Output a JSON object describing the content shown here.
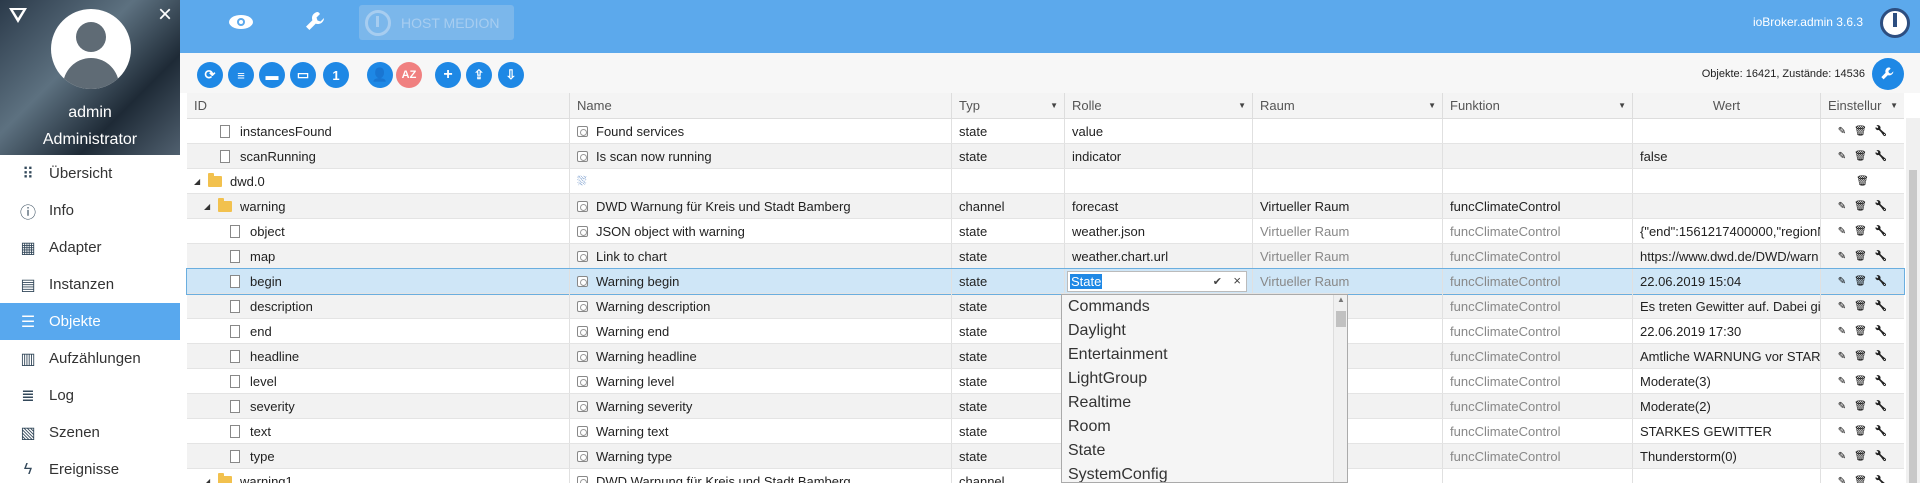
{
  "sidebar": {
    "user_name": "admin",
    "user_role": "Administrator",
    "items": [
      {
        "label": "Übersicht",
        "icon": "grid-icon"
      },
      {
        "label": "Info",
        "icon": "info-icon"
      },
      {
        "label": "Adapter",
        "icon": "store-icon"
      },
      {
        "label": "Instanzen",
        "icon": "instances-icon"
      },
      {
        "label": "Objekte",
        "icon": "list-icon",
        "active": true
      },
      {
        "label": "Aufzählungen",
        "icon": "enum-icon"
      },
      {
        "label": "Log",
        "icon": "log-icon"
      },
      {
        "label": "Szenen",
        "icon": "scenes-icon"
      },
      {
        "label": "Ereignisse",
        "icon": "bolt-icon"
      }
    ]
  },
  "topbar": {
    "host_label": "HOST MEDION",
    "version": "ioBroker.admin 3.6.3"
  },
  "toolbar": {
    "counts": "Objekte: 16421, Zustände: 14536",
    "az_label": "AZ",
    "one_label": "1"
  },
  "columns": {
    "id": "ID",
    "name": "Name",
    "typ": "Typ",
    "rolle": "Rolle",
    "raum": "Raum",
    "funktion": "Funktion",
    "wert": "Wert",
    "einstellungen": "Einstellur"
  },
  "rows": [
    {
      "id": "instancesFound",
      "name": "Found services",
      "typ": "state",
      "rolle": "value",
      "raum": "",
      "funktion": "",
      "wert": ""
    },
    {
      "id": "scanRunning",
      "name": "Is scan now running",
      "typ": "state",
      "rolle": "indicator",
      "raum": "",
      "funktion": "",
      "wert": "false"
    },
    {
      "id": "dwd.0",
      "name": "",
      "typ": "",
      "rolle": "",
      "raum": "",
      "funktion": "",
      "wert": ""
    },
    {
      "id": "warning",
      "name": "DWD Warnung für Kreis und Stadt Bamberg",
      "typ": "channel",
      "rolle": "forecast",
      "raum": "Virtueller Raum",
      "funktion": "funcClimateControl",
      "wert": ""
    },
    {
      "id": "object",
      "name": "JSON object with warning",
      "typ": "state",
      "rolle": "weather.json",
      "raum": "Virtueller Raum",
      "funktion": "funcClimateControl",
      "wert": "{\"end\":1561217400000,\"regionN"
    },
    {
      "id": "map",
      "name": "Link to chart",
      "typ": "state",
      "rolle": "weather.chart.url",
      "raum": "Virtueller Raum",
      "funktion": "funcClimateControl",
      "wert": "https://www.dwd.de/DWD/warn"
    },
    {
      "id": "begin",
      "name": "Warning begin",
      "typ": "state",
      "rolle": "State",
      "raum": "Virtueller Raum",
      "funktion": "funcClimateControl",
      "wert": "22.06.2019 15:04"
    },
    {
      "id": "description",
      "name": "Warning description",
      "typ": "state",
      "rolle": "",
      "raum": "",
      "funktion": "funcClimateControl",
      "wert": "Es treten Gewitter auf. Dabei gib"
    },
    {
      "id": "end",
      "name": "Warning end",
      "typ": "state",
      "rolle": "",
      "raum": "",
      "funktion": "funcClimateControl",
      "wert": "22.06.2019 17:30"
    },
    {
      "id": "headline",
      "name": "Warning headline",
      "typ": "state",
      "rolle": "",
      "raum": "",
      "funktion": "funcClimateControl",
      "wert": "Amtliche WARNUNG vor STARK"
    },
    {
      "id": "level",
      "name": "Warning level",
      "typ": "state",
      "rolle": "",
      "raum": "",
      "funktion": "funcClimateControl",
      "wert": "Moderate(3)"
    },
    {
      "id": "severity",
      "name": "Warning severity",
      "typ": "state",
      "rolle": "",
      "raum": "",
      "funktion": "funcClimateControl",
      "wert": "Moderate(2)"
    },
    {
      "id": "text",
      "name": "Warning text",
      "typ": "state",
      "rolle": "",
      "raum": "",
      "funktion": "funcClimateControl",
      "wert": "STARKES GEWITTER"
    },
    {
      "id": "type",
      "name": "Warning type",
      "typ": "state",
      "rolle": "",
      "raum": "",
      "funktion": "funcClimateControl",
      "wert": "Thunderstorm(0)"
    },
    {
      "id": "warning1",
      "name": "DWD Warnung für Kreis und Stadt Bamberg",
      "typ": "channel",
      "rolle": "",
      "raum": "",
      "funktion": "",
      "wert": ""
    }
  ],
  "dropdown": {
    "options": [
      "Commands",
      "Daylight",
      "Entertainment",
      "LightGroup",
      "Realtime",
      "Room",
      "State",
      "SystemConfig"
    ]
  }
}
